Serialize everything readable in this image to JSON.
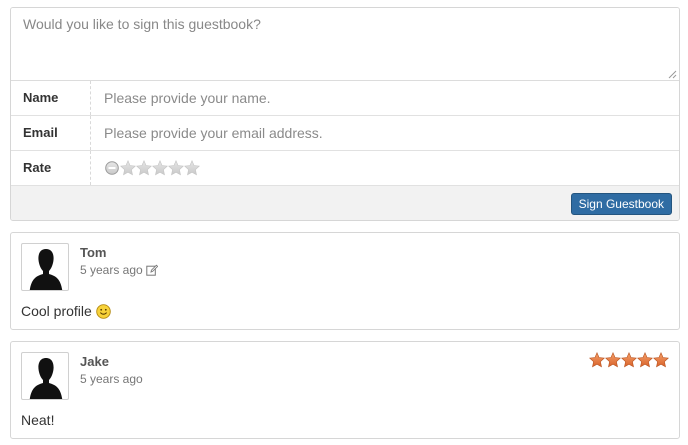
{
  "form": {
    "message_placeholder": "Would you like to sign this guestbook?",
    "name_label": "Name",
    "name_placeholder": "Please provide your name.",
    "email_label": "Email",
    "email_placeholder": "Please provide your email address.",
    "rate_label": "Rate",
    "rating_value": 0,
    "rating_max": 5,
    "submit_label": "Sign Guestbook"
  },
  "entries": [
    {
      "author": "Tom",
      "time": "5 years ago",
      "text": "Cool profile",
      "editable": true,
      "rating": 0,
      "icon": "smiley-icon"
    },
    {
      "author": "Jake",
      "time": "5 years ago",
      "text": "Neat!",
      "editable": false,
      "rating": 5
    }
  ],
  "colors": {
    "button": "#2f6ca3",
    "star_filled": "#e8793a",
    "star_empty": "#d6d6d6"
  }
}
